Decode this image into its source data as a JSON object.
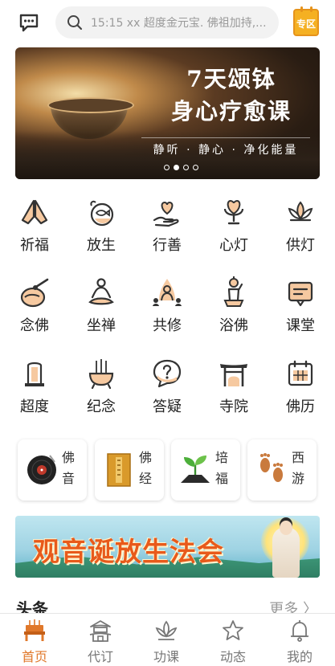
{
  "header": {
    "message_icon": "chat-bubble-icon",
    "search": {
      "icon": "search-icon",
      "placeholder": "15:15 xx 超度金元宝. 佛祖加持,..."
    },
    "zone_button_label": "专区",
    "colors": {
      "zone": "#f5b022"
    }
  },
  "banner": {
    "title_line1": "7天颂钵",
    "title_line2": "身心疗愈课",
    "subtitle": "静听 · 静心 · 净化能量",
    "slides_total": 4,
    "active_slide": 1
  },
  "grid": {
    "rows": [
      [
        {
          "label": "祈福",
          "icon": "praying-hands-icon"
        },
        {
          "label": "放生",
          "icon": "fish-bowl-icon"
        },
        {
          "label": "行善",
          "icon": "heart-in-hand-icon"
        },
        {
          "label": "心灯",
          "icon": "heart-lamp-icon"
        },
        {
          "label": "供灯",
          "icon": "lotus-icon"
        }
      ],
      [
        {
          "label": "念佛",
          "icon": "wooden-fish-icon"
        },
        {
          "label": "坐禅",
          "icon": "meditation-icon"
        },
        {
          "label": "共修",
          "icon": "buddha-group-icon"
        },
        {
          "label": "浴佛",
          "icon": "baby-buddha-icon"
        },
        {
          "label": "课堂",
          "icon": "classroom-board-icon"
        }
      ],
      [
        {
          "label": "超度",
          "icon": "memorial-tablet-icon"
        },
        {
          "label": "纪念",
          "icon": "incense-burner-icon"
        },
        {
          "label": "答疑",
          "icon": "question-bubble-icon"
        },
        {
          "label": "寺院",
          "icon": "temple-gate-icon"
        },
        {
          "label": "佛历",
          "icon": "calendar-icon"
        }
      ]
    ]
  },
  "cards": [
    {
      "label": "佛音",
      "icon": "vinyl-record-icon"
    },
    {
      "label": "佛经",
      "icon": "sutra-book-icon"
    },
    {
      "label": "培福",
      "icon": "sprout-icon"
    },
    {
      "label": "西游",
      "icon": "footprints-icon"
    }
  ],
  "festival_banner": {
    "text": "观音诞放生法会"
  },
  "news": {
    "title": "头条",
    "more": "更多 〉"
  },
  "tabbar": {
    "items": [
      {
        "label": "首页",
        "icon": "altar-home-icon",
        "active": true
      },
      {
        "label": "代订",
        "icon": "temple-icon",
        "active": false
      },
      {
        "label": "功课",
        "icon": "lotus-outline-icon",
        "active": false
      },
      {
        "label": "动态",
        "icon": "star-icon",
        "active": false
      },
      {
        "label": "我的",
        "icon": "bell-icon",
        "active": false
      }
    ],
    "colors": {
      "active": "#e0782a",
      "inactive": "#777777"
    }
  }
}
